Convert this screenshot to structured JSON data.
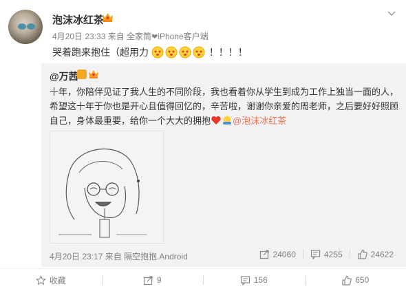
{
  "post": {
    "username": "泡沫冰红茶",
    "meta": "4月20日 23:33 来自 全家筒",
    "meta_device": "iPhone客户端",
    "text": "哭着跑来抱住（超用力",
    "text_tail": "！！！！",
    "emoji_count": 4
  },
  "repost": {
    "username": "@万茜",
    "text": "十年，你陪伴见证了我人生的不同阶段，我也看着你从学生到成为工作上独当一面的人，希望这十年于你也是开心且值得回忆的，辛苦啦，谢谢你亲爱的周老师，之后要好好照顾自己，身体最重要，给你一个大大的拥抱",
    "mention": "@泡沫冰红茶",
    "footer": "4月20日 23:17 来自 隔空抱抱.Android",
    "stats": {
      "forward": "24060",
      "comment": "4255",
      "like": "24622"
    }
  },
  "bottom_bar": {
    "favorite": "收藏",
    "forward": "9",
    "comment": "156",
    "like": "650"
  },
  "colors": {
    "accent": "#eb7350",
    "gray_text": "#808080"
  }
}
